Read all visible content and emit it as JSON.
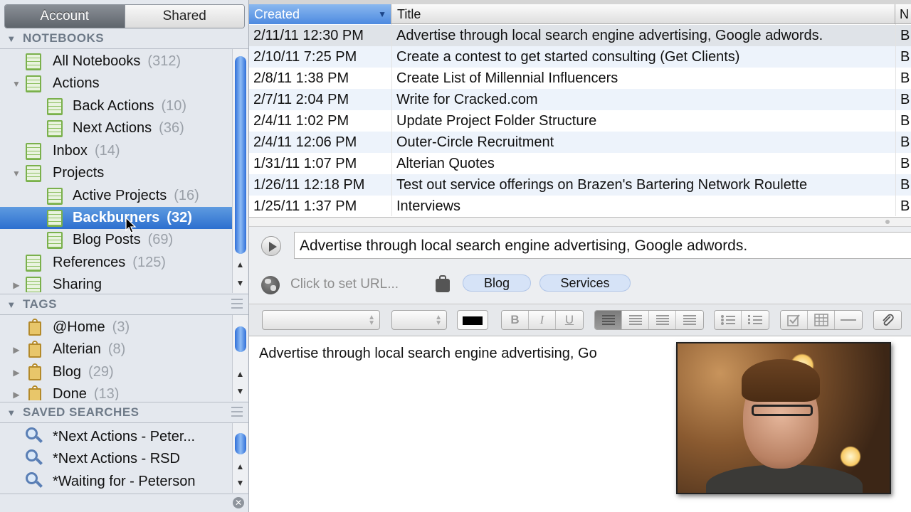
{
  "sidebar": {
    "tabs": [
      {
        "label": "Account",
        "active": true
      },
      {
        "label": "Shared",
        "active": false
      }
    ],
    "notebooks": {
      "header": "NOTEBOOKS",
      "items": [
        {
          "label": "All Notebooks",
          "count": "(312)"
        },
        {
          "label": "Actions",
          "count": ""
        },
        {
          "label": "Back Actions",
          "count": "(10)"
        },
        {
          "label": "Next Actions",
          "count": "(36)"
        },
        {
          "label": "Inbox",
          "count": "(14)"
        },
        {
          "label": "Projects",
          "count": ""
        },
        {
          "label": "Active Projects",
          "count": "(16)"
        },
        {
          "label": "Backburners",
          "count": "(32)",
          "selected": true
        },
        {
          "label": "Blog Posts",
          "count": "(69)"
        },
        {
          "label": "References",
          "count": "(125)"
        },
        {
          "label": "Sharing",
          "count": ""
        }
      ]
    },
    "tags": {
      "header": "TAGS",
      "items": [
        {
          "label": "@Home",
          "count": "(3)"
        },
        {
          "label": "Alterian",
          "count": "(8)"
        },
        {
          "label": "Blog",
          "count": "(29)"
        },
        {
          "label": "Done",
          "count": "(13)"
        }
      ]
    },
    "saved_searches": {
      "header": "SAVED SEARCHES",
      "items": [
        {
          "label": "*Next Actions - Peter..."
        },
        {
          "label": "*Next Actions - RSD"
        },
        {
          "label": "*Waiting for - Peterson"
        }
      ]
    }
  },
  "table": {
    "columns": {
      "created": "Created",
      "title": "Title",
      "notebook": "N"
    },
    "rows": [
      {
        "created": "2/11/11 12:30 PM",
        "title": "Advertise through local search engine advertising, Google adwords.",
        "notebook": "B"
      },
      {
        "created": "2/10/11 7:25 PM",
        "title": "Create a contest to get started consulting (Get Clients)",
        "notebook": "B"
      },
      {
        "created": "2/8/11 1:38 PM",
        "title": "Create List of Millennial Influencers",
        "notebook": "B"
      },
      {
        "created": "2/7/11 2:04 PM",
        "title": "Write for Cracked.com",
        "notebook": "B"
      },
      {
        "created": "2/4/11 1:02 PM",
        "title": "Update Project Folder Structure",
        "notebook": "B"
      },
      {
        "created": "2/4/11 12:06 PM",
        "title": "Outer-Circle Recruitment",
        "notebook": "B"
      },
      {
        "created": "1/31/11 1:07 PM",
        "title": "Alterian Quotes",
        "notebook": "B"
      },
      {
        "created": "1/26/11 12:18 PM",
        "title": "Test out service offerings on Brazen's Bartering Network Roulette",
        "notebook": "B"
      },
      {
        "created": "1/25/11 1:37 PM",
        "title": "Interviews",
        "notebook": "B"
      }
    ]
  },
  "note": {
    "title": "Advertise through local search engine advertising, Google adwords.",
    "url_placeholder": "Click to set URL...",
    "tags": [
      "Blog",
      "Services"
    ],
    "body": "Advertise through local search engine advertising, Go"
  },
  "toolbar": {
    "bold": "B",
    "italic": "I",
    "underline": "U"
  },
  "colors": {
    "selection": "#2d6fcf",
    "accent": "#4d8ae0"
  }
}
